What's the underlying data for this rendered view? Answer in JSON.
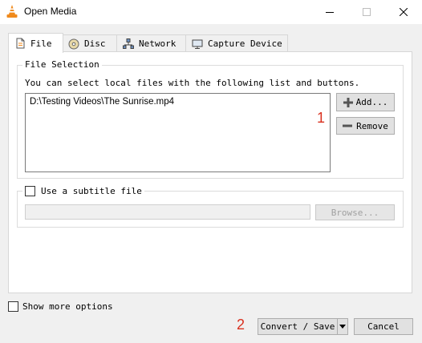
{
  "window": {
    "title": "Open Media",
    "app_icon": "vlc-cone-icon"
  },
  "tabs": [
    {
      "label": "File",
      "icon": "file-icon",
      "active": true
    },
    {
      "label": "Disc",
      "icon": "disc-icon"
    },
    {
      "label": "Network",
      "icon": "network-icon"
    },
    {
      "label": "Capture Device",
      "icon": "capture-device-icon"
    }
  ],
  "file_selection": {
    "group_title": "File Selection",
    "description": "You can select local files with the following list and buttons.",
    "files": [
      "D:\\Testing Videos\\The Sunrise.mp4"
    ],
    "add_label": "Add...",
    "remove_label": "Remove",
    "callout": "1"
  },
  "subtitle": {
    "checkbox_label": "Use a subtitle file",
    "checked": false,
    "path_value": "",
    "browse_label": "Browse..."
  },
  "footer": {
    "show_more_label": "Show more options",
    "show_more_checked": false,
    "convert_label": "Convert / Save",
    "cancel_label": "Cancel",
    "callout": "2"
  },
  "colors": {
    "callout_red": "#d9311f",
    "vlc_orange": "#f08a1c"
  }
}
